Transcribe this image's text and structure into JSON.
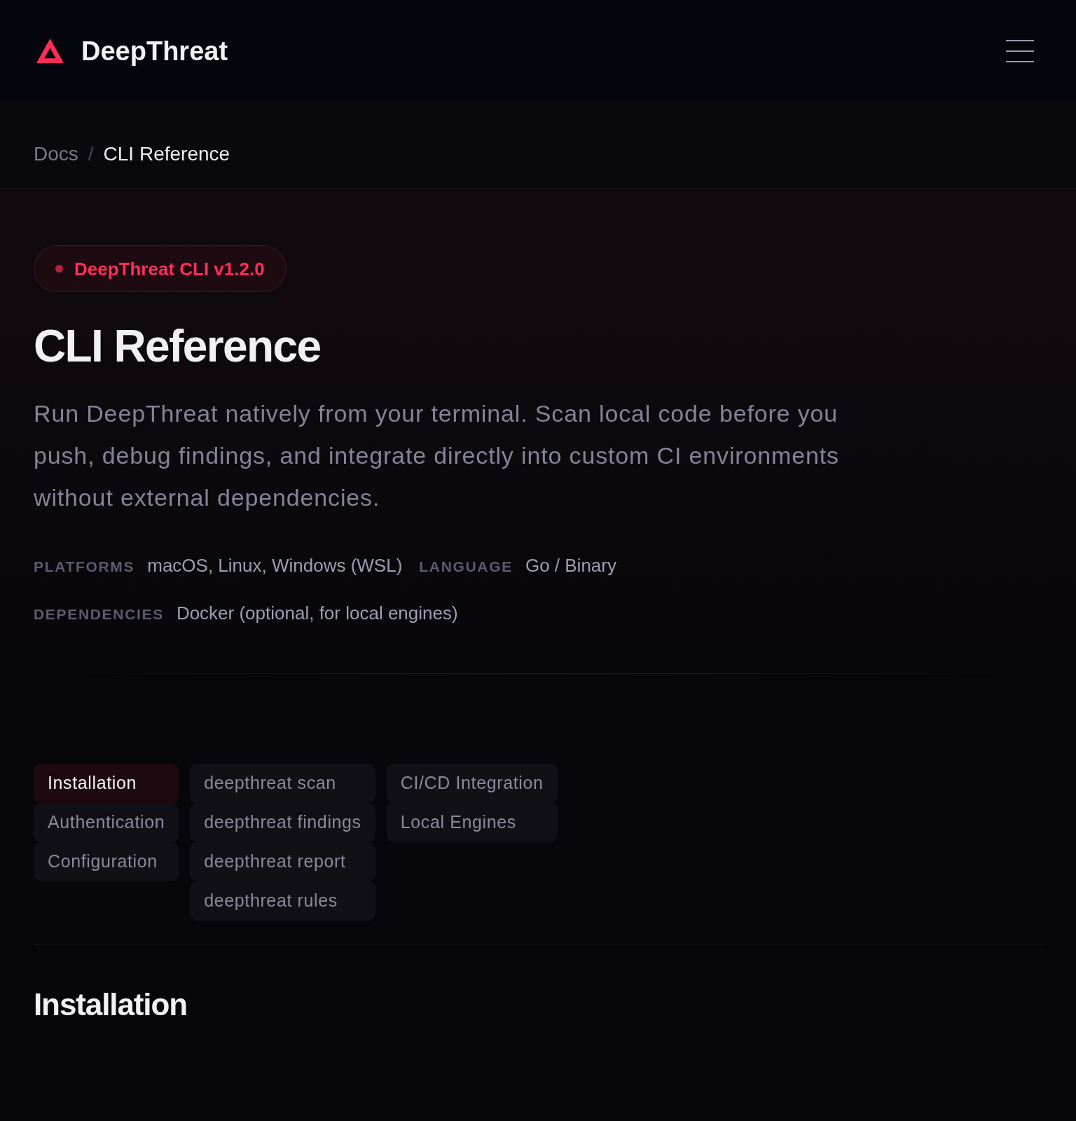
{
  "header": {
    "brand": "DeepThreat"
  },
  "breadcrumb": {
    "separator": "/",
    "items": [
      {
        "label": "Docs",
        "current": false
      },
      {
        "label": "CLI Reference",
        "current": true
      }
    ]
  },
  "hero": {
    "badge": "DeepThreat CLI v1.2.0",
    "title": "CLI Reference",
    "description": "Run DeepThreat natively from your terminal. Scan local code before you push, debug findings, and integrate directly into custom CI environments without external dependencies.",
    "meta": [
      {
        "label": "PLATFORMS",
        "value": "macOS, Linux, Windows (WSL)"
      },
      {
        "label": "LANGUAGE",
        "value": "Go / Binary"
      },
      {
        "label": "DEPENDENCIES",
        "value": "Docker (optional, for local engines)"
      }
    ]
  },
  "section_nav": {
    "groups": [
      {
        "items": [
          {
            "label": "Installation",
            "selected": true
          },
          {
            "label": "Authentication",
            "selected": false
          },
          {
            "label": "Configuration",
            "selected": false
          }
        ]
      },
      {
        "items": [
          {
            "label": "deepthreat scan",
            "selected": false
          },
          {
            "label": "deepthreat findings",
            "selected": false
          },
          {
            "label": "deepthreat report",
            "selected": false
          },
          {
            "label": "deepthreat rules",
            "selected": false
          }
        ]
      },
      {
        "items": [
          {
            "label": "CI/CD Integration",
            "selected": false
          },
          {
            "label": "Local Engines",
            "selected": false
          }
        ]
      }
    ]
  },
  "section": {
    "heading": "Installation"
  }
}
